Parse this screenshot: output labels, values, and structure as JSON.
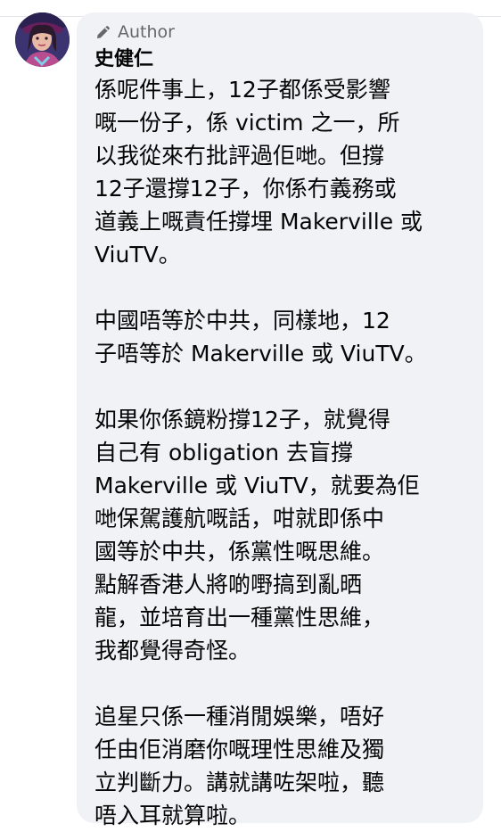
{
  "comment": {
    "author_badge": "Author",
    "author_badge_icon": "pencil-icon",
    "author_name": "史健仁",
    "paragraphs": [
      "係呢件事上，12子都係受影響\n嘅一份子，係 victim 之一，所\n以我從來冇批評過佢哋。但撐\n12子還撐12子，你係冇義務或\n道義上嘅責任撐埋 Makerville 或\nViuTV。",
      "中國唔等於中共，同樣地，12\n子唔等於 Makerville 或 ViuTV。",
      "如果你係鏡粉撐12子，就覺得\n自己有 obligation 去盲撐\nMakerville 或 ViuTV，就要為佢\n哋保駕護航嘅話，咁就即係中\n國等於中共，係黨性嘅思維。\n點解香港人將啲嘢搞到亂晒\n龍，並培育出一種黨性思維，\n我都覺得奇怪。",
      "追星只係一種消閒娛樂，唔好\n任由佢消磨你嘅理性思維及獨\n立判斷力。講就講咗架啦，聽\n唔入耳就算啦。"
    ],
    "bubble_color": "#f0f2f5",
    "badge_color": "#65676b",
    "text_color": "#050505"
  }
}
